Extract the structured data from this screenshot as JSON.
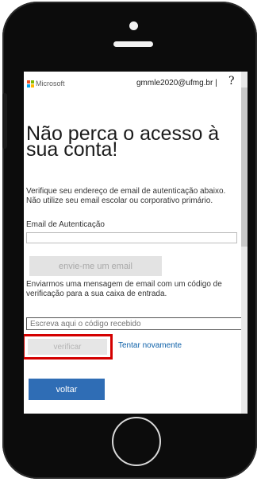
{
  "header": {
    "brand": "Microsoft",
    "account": "gmmle2020@ufmg.br |",
    "help": "?"
  },
  "main": {
    "title": "Não perca o acesso à sua conta!",
    "instructions": "Verifique seu endereço de email de autenticação abaixo. Não utilize seu email escolar ou corporativo primário.",
    "email_label": "Email de Autenticação",
    "email_value": "",
    "send_button": "envie-me um email",
    "sent_message": "Enviarmos uma mensagem de email com um código de verificação para a sua caixa de entrada.",
    "code_placeholder": "Escreva aqui o código recebido",
    "verify_button": "verificar",
    "retry_link": "Tentar novamente",
    "back_button": "voltar"
  },
  "colors": {
    "primary": "#2f6db5",
    "link": "#0b5fa8",
    "highlight": "#d40000",
    "ms_red": "#f25022",
    "ms_green": "#7fba00",
    "ms_blue": "#00a4ef",
    "ms_yellow": "#ffb900"
  }
}
